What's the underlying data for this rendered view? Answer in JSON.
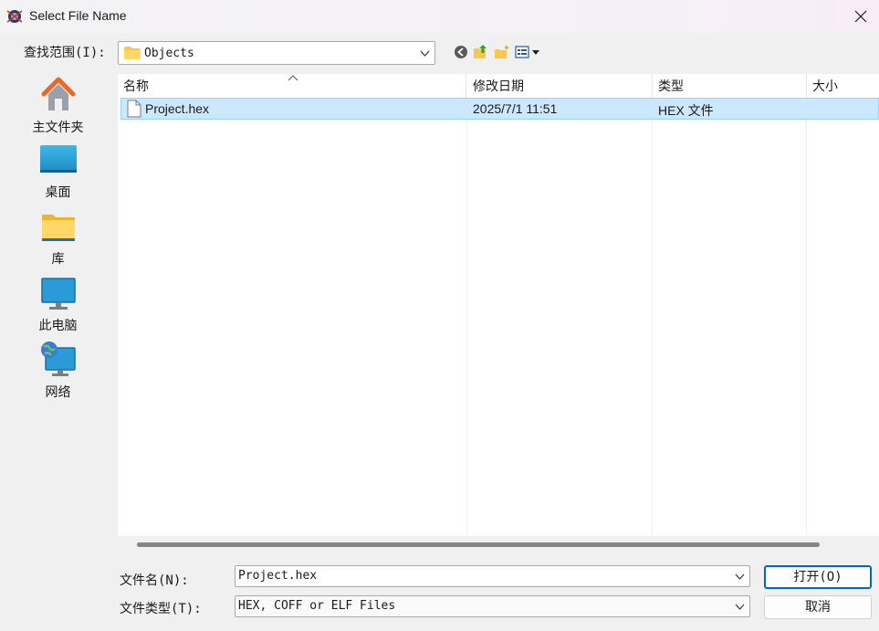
{
  "window": {
    "title": "Select File Name",
    "app_icon": "keil-uvision-icon",
    "close_icon": "close-icon"
  },
  "toolbar": {
    "look_in_label": "查找范围(I):",
    "look_in_value": "Objects",
    "icons": [
      "back-icon",
      "up-folder-icon",
      "new-folder-icon",
      "view-menu-icon"
    ]
  },
  "places": [
    {
      "label": "主文件夹",
      "icon": "home-icon"
    },
    {
      "label": "桌面",
      "icon": "desktop-icon"
    },
    {
      "label": "库",
      "icon": "library-folder-icon"
    },
    {
      "label": "此电脑",
      "icon": "this-pc-icon"
    },
    {
      "label": "网络",
      "icon": "network-icon"
    }
  ],
  "file_list": {
    "columns": [
      "名称",
      "修改日期",
      "类型",
      "大小"
    ],
    "rows": [
      {
        "name": "Project.hex",
        "modified": "2025/7/1 11:51",
        "type": "HEX 文件",
        "size": ""
      }
    ]
  },
  "footer": {
    "filename_label": "文件名(N):",
    "filename_value": "Project.hex",
    "filetype_label": "文件类型(T):",
    "filetype_value": "HEX, COFF or ELF Files",
    "open_button": "打开(O)",
    "cancel_button": "取消"
  },
  "colors": {
    "selection_fill": "#cce8ff",
    "selection_border": "#99d1ff",
    "primary_button_border": "#0067c0"
  }
}
